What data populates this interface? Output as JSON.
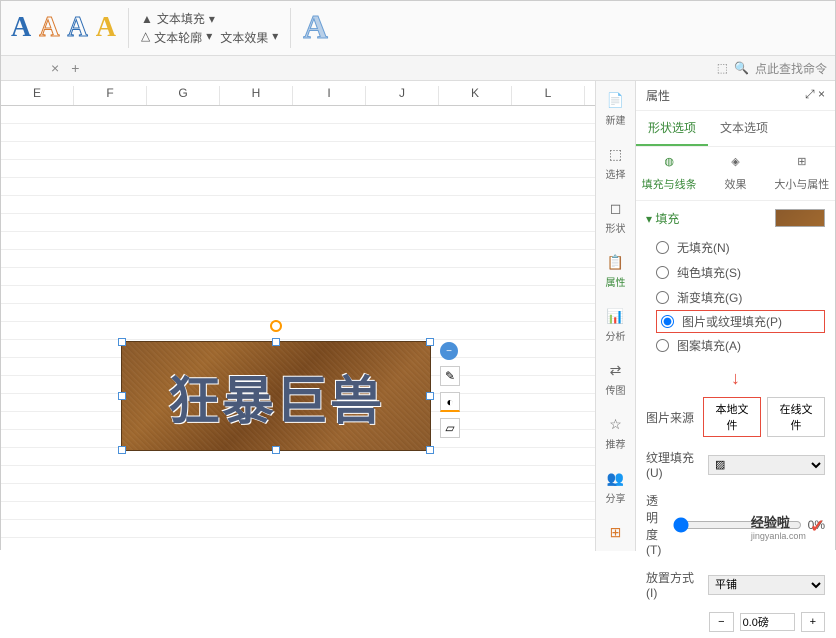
{
  "ribbon": {
    "textFill": "文本填充",
    "textOutline": "文本轮廓",
    "textEffect": "文本效果"
  },
  "tabbar": {
    "searchPlaceholder": "点此查找命令"
  },
  "columns": [
    "E",
    "F",
    "G",
    "H",
    "I",
    "J",
    "K",
    "L"
  ],
  "artbox": {
    "text": "狂暴巨兽"
  },
  "vbar": {
    "new": "新建",
    "select": "选择",
    "shape": "形状",
    "props": "属性",
    "analyze": "分析",
    "transfer": "传图",
    "recommend": "推荐",
    "share": "分享"
  },
  "panel": {
    "title": "属性",
    "tabShape": "形状选项",
    "tabText": "文本选项",
    "subFillLine": "填充与线条",
    "subEffect": "效果",
    "subSize": "大小与属性",
    "fillSection": "填充",
    "noFill": "无填充(N)",
    "solidFill": "纯色填充(S)",
    "gradFill": "渐变填充(G)",
    "picFill": "图片或纹理填充(P)",
    "patternFill": "图案填充(A)",
    "picSource": "图片来源",
    "localFile": "本地文件",
    "onlineFile": "在线文件",
    "texture": "纹理填充(U)",
    "opacity": "透明度(T)",
    "opacityVal": "0%",
    "method": "放置方式(I)",
    "methodVal": "平铺",
    "spinVal": "0.0磅"
  },
  "watermark": {
    "brand": "经验啦",
    "url": "jingyanla.com"
  }
}
